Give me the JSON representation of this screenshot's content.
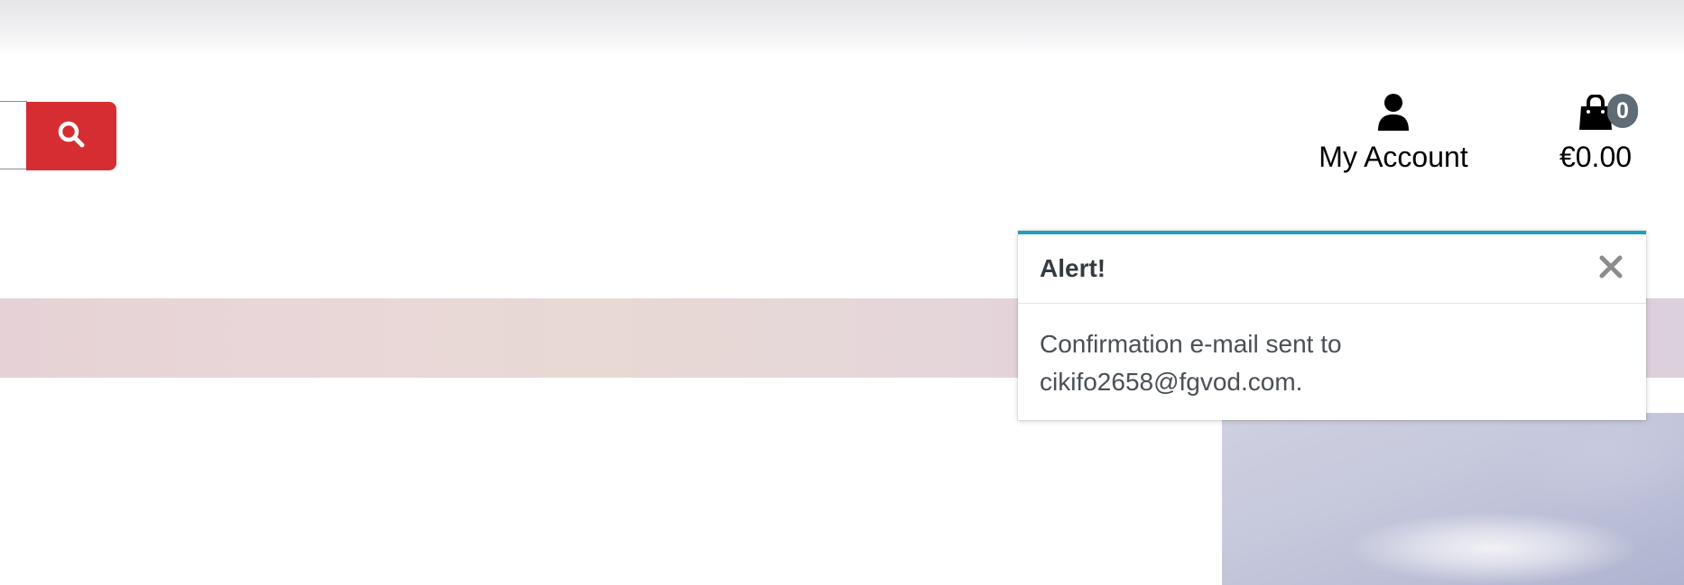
{
  "header": {
    "search": {
      "button_icon": "search-icon",
      "accent_color": "#d62d32"
    },
    "account": {
      "icon": "user-icon",
      "label": "My Account"
    },
    "cart": {
      "icon": "shopping-bag-icon",
      "count": "0",
      "total": "€0.00",
      "badge_color": "#5f6b75"
    }
  },
  "toast": {
    "title": "Alert!",
    "close_icon": "close-icon",
    "message_line1": "Confirmation e-mail sent to",
    "message_line2": "cikifo2658@fgvod.com.",
    "accent_color": "#1f9fb8"
  }
}
